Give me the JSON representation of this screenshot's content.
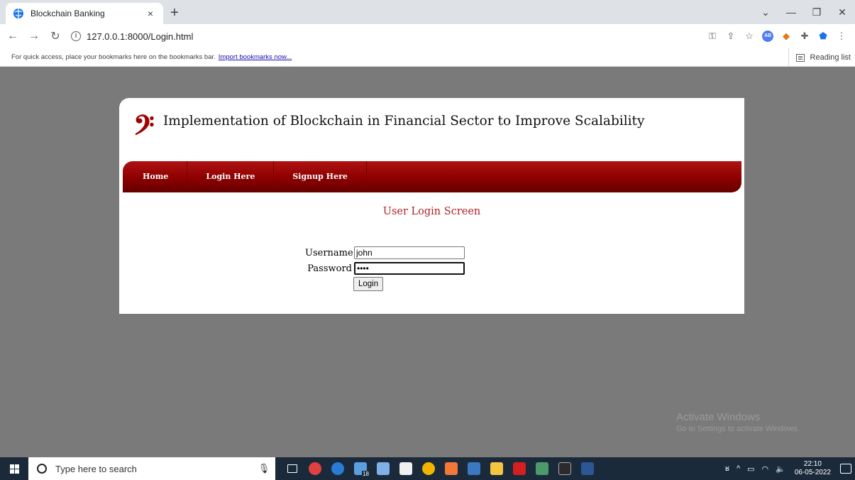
{
  "browser": {
    "tab_title": "Blockchain Banking",
    "tab_close": "×",
    "new_tab": "+",
    "url": "127.0.0.1:8000/Login.html",
    "bookmarks_text": "For quick access, place your bookmarks here on the bookmarks bar.",
    "bookmarks_link": "Import bookmarks now...",
    "reading_list": "Reading list",
    "extension_ab": "AB"
  },
  "page": {
    "logo": "𝄢",
    "site_title": "Implementation of Blockchain in Financial Sector to Improve Scalability",
    "menu": [
      {
        "label": "Home"
      },
      {
        "label": "Login Here"
      },
      {
        "label": "Signup Here"
      }
    ],
    "screen_title": "User Login Screen",
    "form": {
      "username_label": "Username",
      "username_value": "john",
      "password_label": "Password",
      "password_value": "john",
      "login_button": "Login"
    }
  },
  "watermark": {
    "title": "Activate Windows",
    "subtitle": "Go to Settings to activate Windows."
  },
  "taskbar": {
    "search_placeholder": "Type here to search",
    "badge": "18",
    "time": "22:10",
    "date": "06-05-2022"
  },
  "colors": {
    "menu_red": "#8c0000",
    "title_red": "#b0242a",
    "page_bg": "#7a7a7a"
  }
}
